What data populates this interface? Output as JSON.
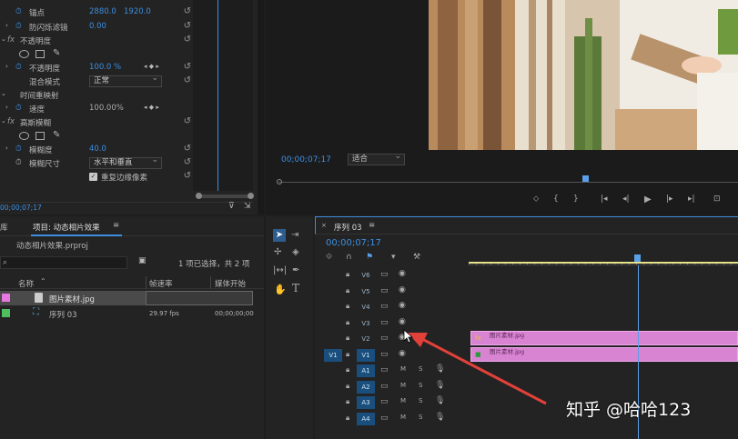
{
  "effect_controls": {
    "rows": [
      {
        "label": "锚点",
        "value1": "2880.0",
        "value2": "1920.0"
      },
      {
        "label": "防闪烁滤镜",
        "value1": "0.00"
      },
      {
        "label": "不透明度",
        "header": true
      },
      {
        "label": "不透明度",
        "value1": "100.0 %"
      },
      {
        "label": "混合模式",
        "dropdown": "正常"
      },
      {
        "label": "时间重映射",
        "header": true
      },
      {
        "label": "速度",
        "value1": "100.00%"
      },
      {
        "label": "高斯模糊",
        "header": true
      },
      {
        "label": "模糊度",
        "value1": "40.0"
      },
      {
        "label": "模糊尺寸",
        "dropdown": "水平和垂直"
      },
      {
        "label": "重复边缘像素",
        "checkbox": true
      }
    ],
    "timecode": "00;00;07;17",
    "fx_label": "fx"
  },
  "program_monitor": {
    "timecode": "00;00;07;17",
    "fit_dropdown": "适合"
  },
  "project_panel": {
    "tab_left": "库",
    "tab_title": "项目: 动态相片效果",
    "project_file": "动态相片效果.prproj",
    "selection_info": "1 项已选择，共 2 项",
    "columns": [
      "名称",
      "帧速率",
      "媒体开始"
    ],
    "items": [
      {
        "name": "图片素材.jpg",
        "fps": "",
        "start": "",
        "color": "#e676e0",
        "selected": true
      },
      {
        "name": "序列 03",
        "fps": "29.97 fps",
        "start": "00;00;00;00",
        "color": "#4fc060",
        "selected": false
      }
    ]
  },
  "timeline": {
    "tab_title": "序列 03",
    "timecode": "00;00;07;17",
    "video_tracks": [
      "V6",
      "V5",
      "V4",
      "V3",
      "V2",
      "V1"
    ],
    "audio_tracks": [
      "A1",
      "A2",
      "A3",
      "A4"
    ],
    "source_patch_video": "V1",
    "clips": [
      {
        "track": "V2",
        "name": "图片素材.jpg",
        "badge": "fx"
      },
      {
        "track": "V1",
        "name": "图片素材.jpg",
        "badge": "■"
      }
    ],
    "mute_label": "M",
    "solo_label": "S"
  },
  "watermark": "知乎 @哈哈123",
  "colors": {
    "accent_blue": "#3d8ee0",
    "clip_pink": "#d983d3",
    "playhead": "#5aa0e8",
    "arrow_red": "#e2413a"
  }
}
